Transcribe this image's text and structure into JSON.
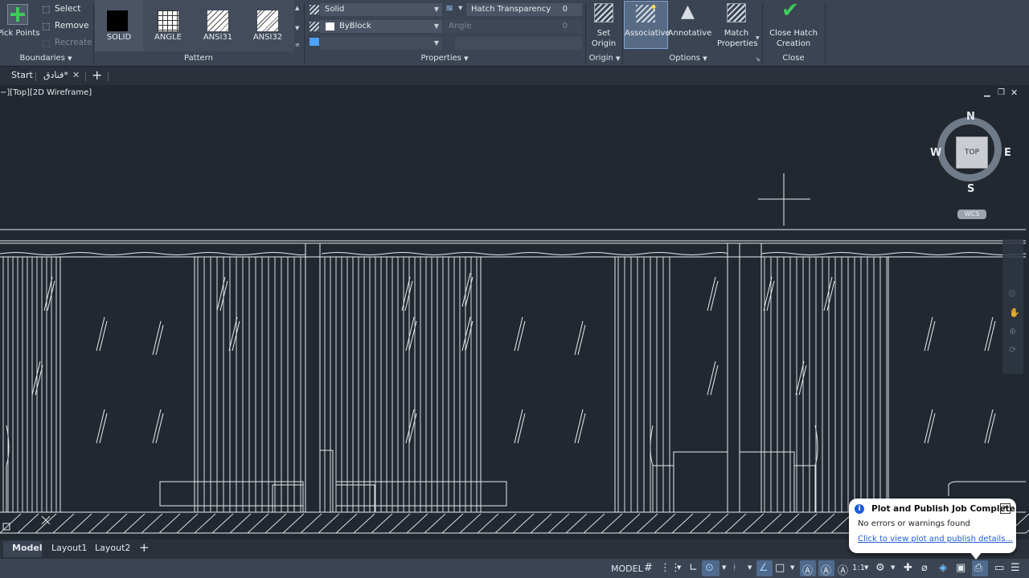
{
  "ribbon": {
    "boundaries": {
      "pick_points": "Pick Points",
      "select": "Select",
      "remove": "Remove",
      "recreate": "Recreate",
      "panel_label": "Boundaries"
    },
    "pattern": {
      "items": [
        "SOLID",
        "ANGLE",
        "ANSI31",
        "ANSI32"
      ],
      "panel_label": "Pattern"
    },
    "properties": {
      "hatch_type": "Solid",
      "hatch_color": "ByBlock",
      "transparency_label": "Hatch Transparency",
      "transparency_value": "0",
      "angle_label": "Angle",
      "angle_value": "0",
      "panel_label": "Properties"
    },
    "origin": {
      "set_origin": "Set Origin",
      "panel_label": "Origin"
    },
    "options": {
      "associative": "Associative",
      "annotative": "Annotative",
      "match_properties": "Match Properties",
      "panel_label": "Options"
    },
    "close": {
      "close_hatch": "Close Hatch Creation",
      "panel_label": "Close"
    }
  },
  "file_tabs": {
    "start": "Start",
    "drawing": "فنادق*",
    "add": "+"
  },
  "viewport": {
    "label": "−][Top][2D Wireframe]",
    "viewcube": {
      "top": "TOP",
      "north": "N",
      "south": "S",
      "east": "E",
      "west": "W",
      "ucs": "WCS"
    }
  },
  "layout_tabs": {
    "model": "Model",
    "layout1": "Layout1",
    "layout2": "Layout2",
    "add": "+"
  },
  "statusbar": {
    "mode": "MODEL",
    "scale": "1:1"
  },
  "notification": {
    "title": "Plot and Publish Job Complete",
    "message": "No errors or warnings found",
    "link": "Click to view plot and publish details..."
  },
  "colors": {
    "ribbon_bg": "#3b4453",
    "canvas_bg": "#212830",
    "accent_green": "#3fca5a",
    "link_blue": "#1e5bd8"
  }
}
